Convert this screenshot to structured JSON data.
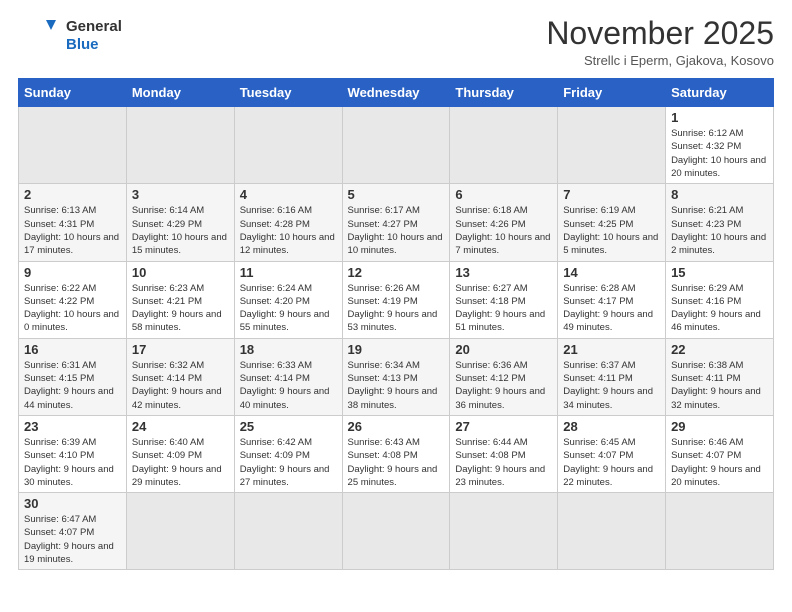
{
  "header": {
    "logo_general": "General",
    "logo_blue": "Blue",
    "month_title": "November 2025",
    "subtitle": "Strellc i Eperm, Gjakova, Kosovo"
  },
  "days_of_week": [
    "Sunday",
    "Monday",
    "Tuesday",
    "Wednesday",
    "Thursday",
    "Friday",
    "Saturday"
  ],
  "weeks": [
    [
      {
        "day": "",
        "info": ""
      },
      {
        "day": "",
        "info": ""
      },
      {
        "day": "",
        "info": ""
      },
      {
        "day": "",
        "info": ""
      },
      {
        "day": "",
        "info": ""
      },
      {
        "day": "",
        "info": ""
      },
      {
        "day": "1",
        "info": "Sunrise: 6:12 AM\nSunset: 4:32 PM\nDaylight: 10 hours and 20 minutes."
      }
    ],
    [
      {
        "day": "2",
        "info": "Sunrise: 6:13 AM\nSunset: 4:31 PM\nDaylight: 10 hours and 17 minutes."
      },
      {
        "day": "3",
        "info": "Sunrise: 6:14 AM\nSunset: 4:29 PM\nDaylight: 10 hours and 15 minutes."
      },
      {
        "day": "4",
        "info": "Sunrise: 6:16 AM\nSunset: 4:28 PM\nDaylight: 10 hours and 12 minutes."
      },
      {
        "day": "5",
        "info": "Sunrise: 6:17 AM\nSunset: 4:27 PM\nDaylight: 10 hours and 10 minutes."
      },
      {
        "day": "6",
        "info": "Sunrise: 6:18 AM\nSunset: 4:26 PM\nDaylight: 10 hours and 7 minutes."
      },
      {
        "day": "7",
        "info": "Sunrise: 6:19 AM\nSunset: 4:25 PM\nDaylight: 10 hours and 5 minutes."
      },
      {
        "day": "8",
        "info": "Sunrise: 6:21 AM\nSunset: 4:23 PM\nDaylight: 10 hours and 2 minutes."
      }
    ],
    [
      {
        "day": "9",
        "info": "Sunrise: 6:22 AM\nSunset: 4:22 PM\nDaylight: 10 hours and 0 minutes."
      },
      {
        "day": "10",
        "info": "Sunrise: 6:23 AM\nSunset: 4:21 PM\nDaylight: 9 hours and 58 minutes."
      },
      {
        "day": "11",
        "info": "Sunrise: 6:24 AM\nSunset: 4:20 PM\nDaylight: 9 hours and 55 minutes."
      },
      {
        "day": "12",
        "info": "Sunrise: 6:26 AM\nSunset: 4:19 PM\nDaylight: 9 hours and 53 minutes."
      },
      {
        "day": "13",
        "info": "Sunrise: 6:27 AM\nSunset: 4:18 PM\nDaylight: 9 hours and 51 minutes."
      },
      {
        "day": "14",
        "info": "Sunrise: 6:28 AM\nSunset: 4:17 PM\nDaylight: 9 hours and 49 minutes."
      },
      {
        "day": "15",
        "info": "Sunrise: 6:29 AM\nSunset: 4:16 PM\nDaylight: 9 hours and 46 minutes."
      }
    ],
    [
      {
        "day": "16",
        "info": "Sunrise: 6:31 AM\nSunset: 4:15 PM\nDaylight: 9 hours and 44 minutes."
      },
      {
        "day": "17",
        "info": "Sunrise: 6:32 AM\nSunset: 4:14 PM\nDaylight: 9 hours and 42 minutes."
      },
      {
        "day": "18",
        "info": "Sunrise: 6:33 AM\nSunset: 4:14 PM\nDaylight: 9 hours and 40 minutes."
      },
      {
        "day": "19",
        "info": "Sunrise: 6:34 AM\nSunset: 4:13 PM\nDaylight: 9 hours and 38 minutes."
      },
      {
        "day": "20",
        "info": "Sunrise: 6:36 AM\nSunset: 4:12 PM\nDaylight: 9 hours and 36 minutes."
      },
      {
        "day": "21",
        "info": "Sunrise: 6:37 AM\nSunset: 4:11 PM\nDaylight: 9 hours and 34 minutes."
      },
      {
        "day": "22",
        "info": "Sunrise: 6:38 AM\nSunset: 4:11 PM\nDaylight: 9 hours and 32 minutes."
      }
    ],
    [
      {
        "day": "23",
        "info": "Sunrise: 6:39 AM\nSunset: 4:10 PM\nDaylight: 9 hours and 30 minutes."
      },
      {
        "day": "24",
        "info": "Sunrise: 6:40 AM\nSunset: 4:09 PM\nDaylight: 9 hours and 29 minutes."
      },
      {
        "day": "25",
        "info": "Sunrise: 6:42 AM\nSunset: 4:09 PM\nDaylight: 9 hours and 27 minutes."
      },
      {
        "day": "26",
        "info": "Sunrise: 6:43 AM\nSunset: 4:08 PM\nDaylight: 9 hours and 25 minutes."
      },
      {
        "day": "27",
        "info": "Sunrise: 6:44 AM\nSunset: 4:08 PM\nDaylight: 9 hours and 23 minutes."
      },
      {
        "day": "28",
        "info": "Sunrise: 6:45 AM\nSunset: 4:07 PM\nDaylight: 9 hours and 22 minutes."
      },
      {
        "day": "29",
        "info": "Sunrise: 6:46 AM\nSunset: 4:07 PM\nDaylight: 9 hours and 20 minutes."
      }
    ],
    [
      {
        "day": "30",
        "info": "Sunrise: 6:47 AM\nSunset: 4:07 PM\nDaylight: 9 hours and 19 minutes."
      },
      {
        "day": "",
        "info": ""
      },
      {
        "day": "",
        "info": ""
      },
      {
        "day": "",
        "info": ""
      },
      {
        "day": "",
        "info": ""
      },
      {
        "day": "",
        "info": ""
      },
      {
        "day": "",
        "info": ""
      }
    ]
  ]
}
